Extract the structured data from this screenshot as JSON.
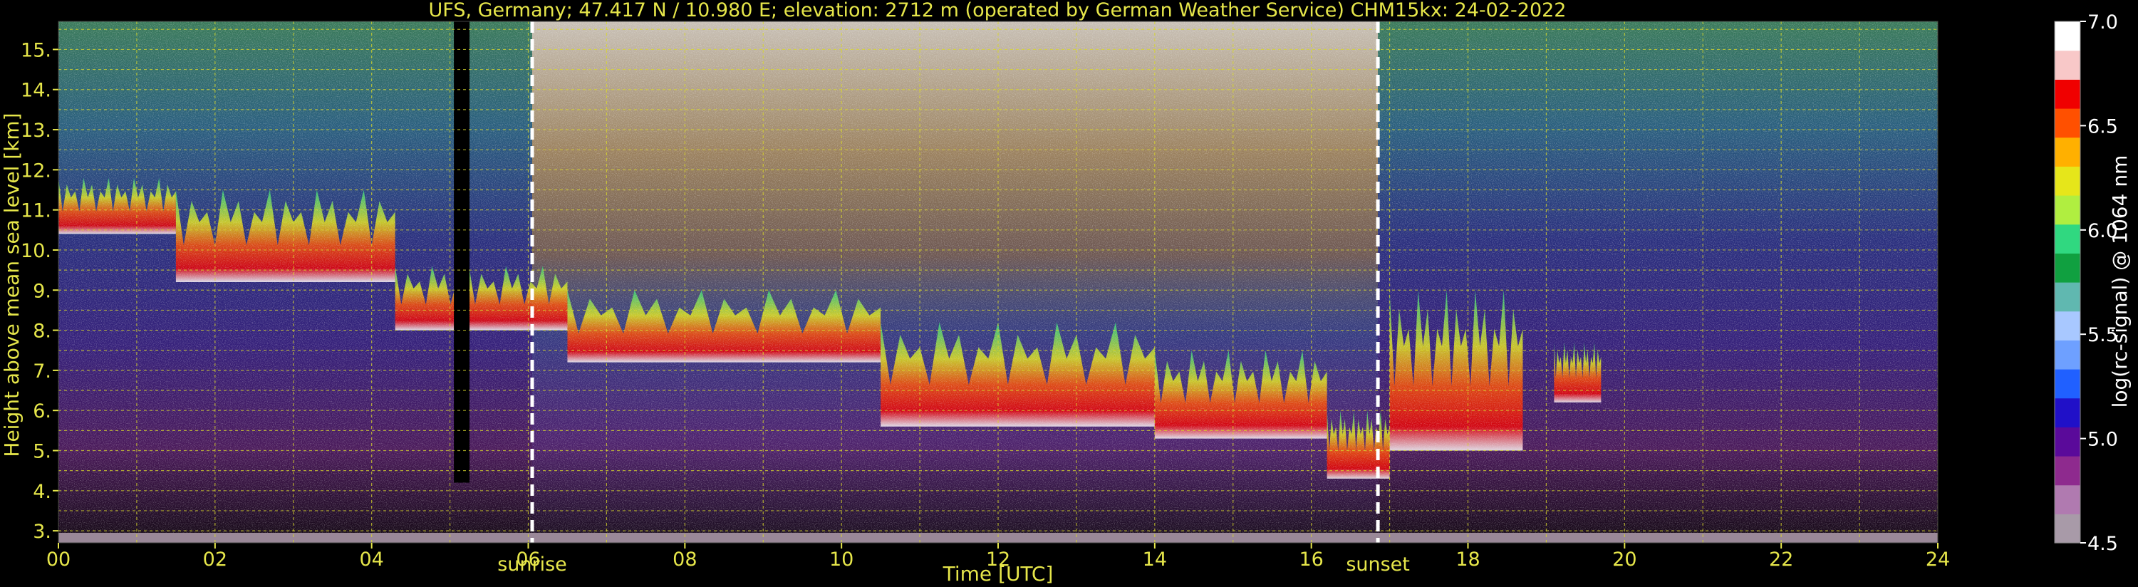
{
  "chart_data": {
    "type": "heatmap",
    "title": "UFS, Germany; 47.417 N / 10.980 E; elevation: 2712 m  (operated by German Weather Service)    CHM15kx: 24-02-2022",
    "xlabel": "Time [UTC]",
    "ylabel": "Height above mean sea level [km]",
    "colorbar_label": "log(rc-signal) @ 1064 nm",
    "x_ticks": [
      "00",
      "02",
      "04",
      "06",
      "08",
      "10",
      "12",
      "14",
      "16",
      "18",
      "20",
      "22",
      "24"
    ],
    "y_ticks": [
      "3.",
      "4.",
      "5.",
      "6.",
      "7.",
      "8.",
      "9.",
      "10.",
      "11.",
      "12.",
      "13.",
      "14.",
      "15."
    ],
    "colorbar_ticks": [
      "7.0",
      "6.5",
      "6.0",
      "5.5",
      "5.0",
      "4.5"
    ],
    "xlim": [
      0,
      24
    ],
    "ylim": [
      2.7,
      15.7
    ],
    "clim": [
      4.5,
      7.0
    ],
    "grid": true,
    "markers": [
      {
        "label": "sunrise",
        "time": 6.05
      },
      {
        "label": "sunset",
        "time": 16.85
      }
    ],
    "cloud_layers": [
      {
        "t_start": 0.0,
        "t_end": 1.5,
        "base_km": 10.4,
        "top_km": 11.8
      },
      {
        "t_start": 1.5,
        "t_end": 4.3,
        "base_km": 9.2,
        "top_km": 11.5
      },
      {
        "t_start": 4.3,
        "t_end": 6.5,
        "base_km": 8.0,
        "top_km": 9.6
      },
      {
        "t_start": 6.5,
        "t_end": 10.5,
        "base_km": 7.2,
        "top_km": 9.0
      },
      {
        "t_start": 10.5,
        "t_end": 14.0,
        "base_km": 5.6,
        "top_km": 8.2
      },
      {
        "t_start": 14.0,
        "t_end": 16.2,
        "base_km": 5.3,
        "top_km": 7.5
      },
      {
        "t_start": 16.2,
        "t_end": 17.0,
        "base_km": 4.3,
        "top_km": 6.0
      },
      {
        "t_start": 17.0,
        "t_end": 18.7,
        "base_km": 5.0,
        "top_km": 9.0
      },
      {
        "t_start": 19.1,
        "t_end": 19.7,
        "base_km": 6.2,
        "top_km": 7.7
      }
    ],
    "colorscale": [
      "#a89aa8",
      "#b07ab0",
      "#8e2a8e",
      "#5a0a9a",
      "#2010c8",
      "#2060ff",
      "#6ea0ff",
      "#a8c8ff",
      "#60b8b0",
      "#10a040",
      "#30d880",
      "#b0ee40",
      "#e6e61a",
      "#ffb000",
      "#ff5000",
      "#f00000",
      "#f8c8c8",
      "#ffffff"
    ]
  }
}
